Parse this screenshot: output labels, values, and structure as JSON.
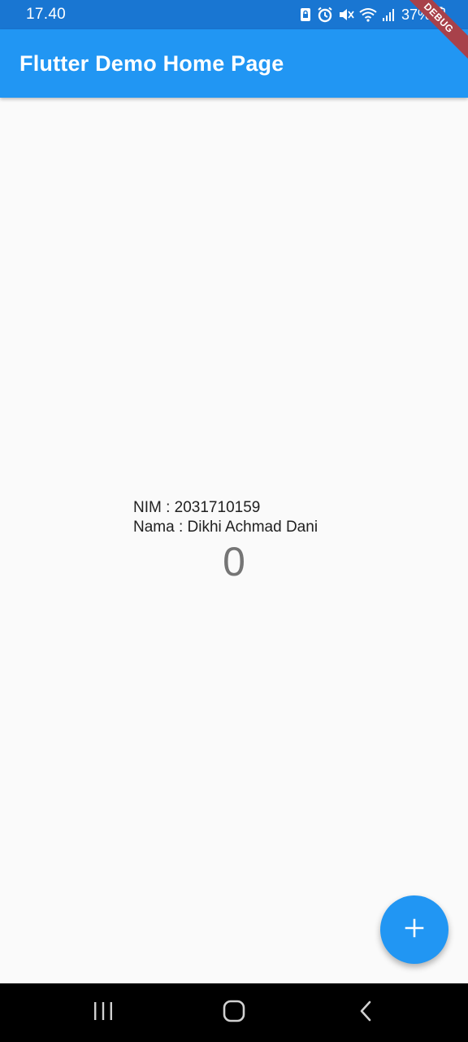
{
  "status_bar": {
    "time": "17.40",
    "battery": "37%",
    "icons": [
      "sim-lock-icon",
      "alarm-icon",
      "mute-icon",
      "wifi-icon",
      "signal-icon",
      "battery-icon"
    ],
    "background": "#1976d2"
  },
  "app_bar": {
    "title": "Flutter Demo Home Page",
    "background": "#2196f3"
  },
  "debug_banner": {
    "label": "DEBUG",
    "color": "#a8414a"
  },
  "body": {
    "nim_line": "NIM : 2031710159",
    "nama_line": "Nama : Dikhi Achmad Dani",
    "counter": "0"
  },
  "fab": {
    "icon": "add-icon",
    "color": "#2196f3"
  },
  "nav_bar": {
    "buttons": [
      "recent-apps-icon",
      "home-icon",
      "back-icon"
    ]
  }
}
